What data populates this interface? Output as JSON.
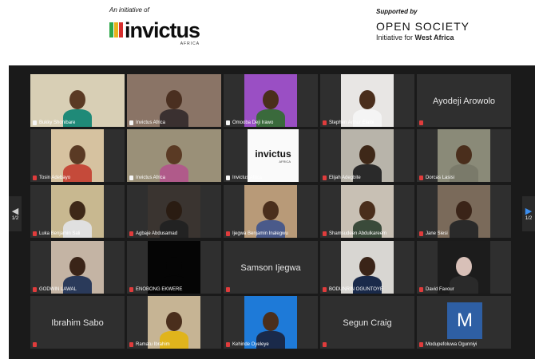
{
  "header": {
    "left_tagline": "An initiative of",
    "left_brand": "invictus",
    "left_sub": "AFRICA",
    "right_tagline": "Supported by",
    "right_brand": "OPEN SOCIETY",
    "right_sub_prefix": "Initiative for ",
    "right_sub_bold": "West Africa"
  },
  "pager": {
    "left": "1/2",
    "right": "1/2"
  },
  "participants": [
    {
      "name": "Bukky Shonibare",
      "muted": false,
      "video": true,
      "bg": "#d8cfb5",
      "skin": "#5a3a24",
      "shirt": "#1f8a78"
    },
    {
      "name": "Invictus Africa",
      "muted": false,
      "video": true,
      "bg": "#8a7466",
      "skin": "#4a2f20",
      "shirt": "#3a3030"
    },
    {
      "name": "Omooba Deji Irawo",
      "muted": false,
      "video": true,
      "bg": "#9a4fc4",
      "skin": "#4a2e1c",
      "shirt": "#3a6a3c"
    },
    {
      "name": "Stephen Arthur Elaibi",
      "muted": true,
      "video": true,
      "bg": "#e8e6e4",
      "skin": "#4a2e1c",
      "shirt": "#f4f4f4"
    },
    {
      "name": "Ayodeji Arowolo",
      "muted": true,
      "video": false
    },
    {
      "name": "Tosin Adebayo",
      "muted": true,
      "video": true,
      "bg": "#d6c2a0",
      "skin": "#5a3a24",
      "shirt": "#c54a3a"
    },
    {
      "name": "Invictus Africa",
      "muted": false,
      "video": true,
      "bg": "#9a9078",
      "skin": "#5a3a24",
      "shirt": "#b05a8a"
    },
    {
      "name": "Invictus Africa",
      "muted": false,
      "video": true,
      "logo": true
    },
    {
      "name": "Elijah Adegbite",
      "muted": true,
      "video": true,
      "bg": "#b8b4aa",
      "skin": "#3e2818",
      "shirt": "#2a2a2a"
    },
    {
      "name": "Dorcas Lasisi",
      "muted": true,
      "video": true,
      "bg": "#8a8a78",
      "skin": "#4a2e1c",
      "shirt": "#7a7a6a"
    },
    {
      "name": "Luka Benjamin Sali",
      "muted": true,
      "video": true,
      "bg": "#c8b890",
      "skin": "#3e2818",
      "shirt": "#e0e0e0"
    },
    {
      "name": "Agbaje Abdusamad",
      "muted": true,
      "video": true,
      "bg": "#3a3430",
      "skin": "#2a1c12",
      "shirt": "#222"
    },
    {
      "name": "Ijegwa Benjamin Inalegwu",
      "muted": true,
      "video": true,
      "bg": "#b89a78",
      "skin": "#4a2e1c",
      "shirt": "#4a5a8a"
    },
    {
      "name": "Shamsudeen Abdulkareem",
      "muted": true,
      "video": true,
      "bg": "#c8c0b4",
      "skin": "#4a2e1c",
      "shirt": "#3a4a3a"
    },
    {
      "name": "Jane Siesi",
      "muted": true,
      "video": true,
      "bg": "#7a6a5a",
      "skin": "#3a2418",
      "shirt": "#2a2a2a"
    },
    {
      "name": "GODWIN LAWAL",
      "muted": true,
      "video": true,
      "bg": "#c4b4a4",
      "skin": "#3a2418",
      "shirt": "#2a3a5a"
    },
    {
      "name": "ENOBONG EKWERE",
      "muted": true,
      "video": true,
      "bg": "#050505",
      "skin": "#050505",
      "shirt": "#050505"
    },
    {
      "name": "Samson Ijegwa",
      "muted": true,
      "video": false
    },
    {
      "name": "BODUNRIN OGUNTOYE",
      "muted": true,
      "video": true,
      "bg": "#d8d6d2",
      "skin": "#3a2418",
      "shirt": "#1a2a4a"
    },
    {
      "name": "David Favour",
      "muted": true,
      "video": true,
      "bg": "#1c1c1c",
      "skin": "#d8c0b8",
      "shirt": "#2a2a2a"
    },
    {
      "name": "Ibrahim Sabo",
      "muted": true,
      "video": false
    },
    {
      "name": "Ramatu Ibrahim",
      "muted": true,
      "video": true,
      "bg": "#c6b494",
      "skin": "#4a2e1c",
      "shirt": "#e0b41c"
    },
    {
      "name": "Kehinde Oyeleye",
      "muted": true,
      "video": true,
      "bg": "#1e7ad8",
      "skin": "#4a2e1c",
      "shirt": "#1a2a4a"
    },
    {
      "name": "Segun Craig",
      "muted": true,
      "video": false
    },
    {
      "name": "Modupefoluwa Ogunniyi",
      "muted": true,
      "video": true,
      "letter": "M"
    }
  ]
}
